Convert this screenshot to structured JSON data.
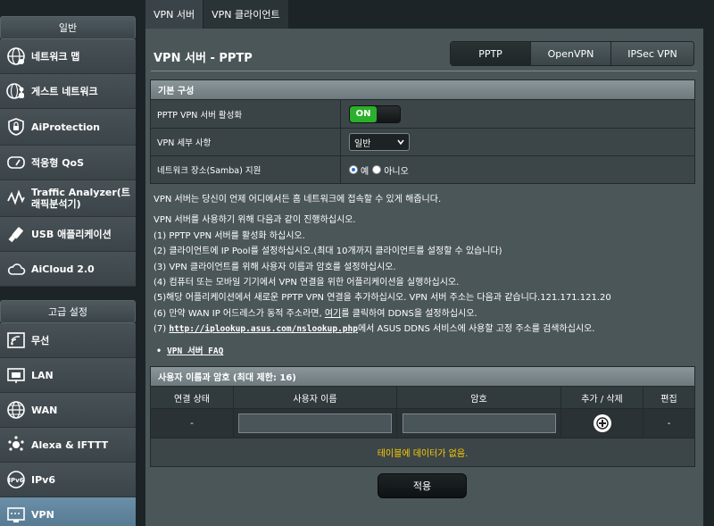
{
  "sidebar": {
    "general_header": "일반",
    "general_items": [
      {
        "label": "네트워크 맵",
        "icon": "network-map-icon"
      },
      {
        "label": "게스트 네트워크",
        "icon": "guest-network-icon"
      },
      {
        "label": "AiProtection",
        "icon": "shield-lock-icon"
      },
      {
        "label": "적응형 QoS",
        "icon": "speedometer-icon"
      },
      {
        "label": "Traffic Analyzer(트래픽분석기)",
        "icon": "traffic-wave-icon"
      },
      {
        "label": "USB 애플리케이션",
        "icon": "usb-icon"
      },
      {
        "label": "AiCloud 2.0",
        "icon": "cloud-icon"
      }
    ],
    "advanced_header": "고급 설정",
    "advanced_items": [
      {
        "label": "무선",
        "icon": "wireless-icon"
      },
      {
        "label": "LAN",
        "icon": "lan-icon"
      },
      {
        "label": "WAN",
        "icon": "globe-icon"
      },
      {
        "label": "Alexa & IFTTT",
        "icon": "alexa-icon"
      },
      {
        "label": "IPv6",
        "icon": "ipv6-icon"
      },
      {
        "label": "VPN",
        "icon": "vpn-icon"
      }
    ]
  },
  "tabs": [
    {
      "label": "VPN 서버"
    },
    {
      "label": "VPN 클라이언트"
    }
  ],
  "main": {
    "title": "VPN 서버 - PPTP",
    "segments": [
      {
        "label": "PPTP"
      },
      {
        "label": "OpenVPN"
      },
      {
        "label": "IPSec VPN"
      }
    ],
    "basic": {
      "header": "기본 구성",
      "enable_label": "PPTP VPN 서버 활성화",
      "enable_value": "ON",
      "details_label": "VPN 세부 사항",
      "details_value": "일반",
      "samba_label": "네트워크 장소(Samba) 지원",
      "samba_yes": "예",
      "samba_no": "아니오"
    },
    "description": {
      "intro": "VPN 서버는 당신이 언제 어디에서든 홈 네트워크에 접속할 수 있게 해줍니다.",
      "steps_intro": "VPN 서버를 사용하기 위해 다음과 같이 진행하십시오.",
      "step1": "(1) PPTP VPN 서버를 활성화 하십시오.",
      "step2": "(2) 클라이언트에 IP Pool를 설정하십시오.(최대 10개까지 클라이언트를 설정할 수 있습니다)",
      "step3": "(3) VPN 클라이언트를 위해 사용자 이름과 암호를 설정하십시오.",
      "step4": "(4) 컴퓨터 또는 모바일 기기에서 VPN 연결을 위한 어플리케이션을 실행하십시오.",
      "step5": "(5)해당 어플리케이션에서 새로운 PPTP VPN 연결을 추가하십시오. VPN 서버 주소는 다음과 같습니다.121.171.121.20",
      "step6_a": "(6) 만약 WAN IP 어드레스가 동적 주소라면, ",
      "step6_link": "여기",
      "step6_b": "를 클릭하여 DDNS을 설정하십시오.",
      "step7_a": "(7) ",
      "step7_link": "http://iplookup.asus.com/nslookup.php",
      "step7_b": "에서 ASUS DDNS 서비스에 사용할 고정 주소를 검색하십시오.",
      "faq": "VPN 서버 FAQ"
    },
    "users": {
      "header": "사용자 이름과 암호 (최대 제한: 16)",
      "columns": [
        "연결 상태",
        "사용자 이름",
        "암호",
        "추가 / 삭제",
        "편집"
      ],
      "input_status": "-",
      "input_edit": "-",
      "empty_text": "테이블에 데이터가 없음."
    },
    "apply_label": "적용"
  }
}
